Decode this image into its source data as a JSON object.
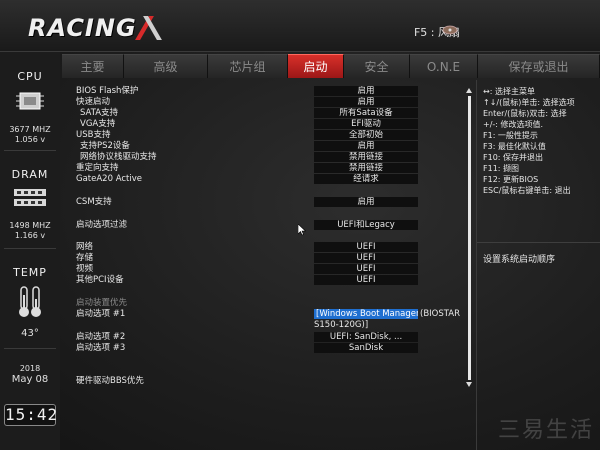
{
  "header": {
    "logo": "RACING",
    "fan_label": "F5 : 风扇"
  },
  "tabs": [
    {
      "label": "主要",
      "active": false
    },
    {
      "label": "高级",
      "active": false
    },
    {
      "label": "芯片组",
      "active": false
    },
    {
      "label": "启动",
      "active": true
    },
    {
      "label": "安全",
      "active": false
    },
    {
      "label": "O.N.E",
      "active": false
    },
    {
      "label": "保存或退出",
      "active": false
    }
  ],
  "sidebar": {
    "cpu_title": "CPU",
    "cpu_freq": "3677 MHZ",
    "cpu_volt": "1.056 v",
    "dram_title": "DRAM",
    "dram_freq": "1498 MHZ",
    "dram_volt": "1.166 v",
    "temp_title": "TEMP",
    "temp_value": "43°",
    "year": "2018",
    "date": "May 08",
    "time": "15:42"
  },
  "settings": [
    {
      "label": "BIOS Flash保护",
      "value": "启用"
    },
    {
      "label": "快速启动",
      "value": "启用"
    },
    {
      "label": "SATA支持",
      "value": "所有Sata设备",
      "indent": true
    },
    {
      "label": "VGA支持",
      "value": "EFI驱动",
      "indent": true
    },
    {
      "label": "USB支持",
      "value": "全部初始"
    },
    {
      "label": "支持PS2设备",
      "value": "启用",
      "indent": true
    },
    {
      "label": "网络协议栈驱动支持",
      "value": "禁用链接",
      "indent": true
    },
    {
      "label": "重定向支持",
      "value": "禁用链接"
    },
    {
      "label": "GateA20 Active",
      "value": "经请求"
    },
    {
      "label": "CSM支持",
      "value": "启用"
    },
    {
      "label": "启动选项过滤",
      "value": "UEFI和Legacy"
    },
    {
      "label": "网络",
      "value": "UEFI"
    },
    {
      "label": "存储",
      "value": "UEFI"
    },
    {
      "label": "视频",
      "value": "UEFI"
    },
    {
      "label": "其他PCI设备",
      "value": "UEFI"
    },
    {
      "label": "启动装置优先",
      "value": ""
    },
    {
      "label": "启动选项 #1",
      "value": "[Windows Boot Manager",
      "extra": "(BIOSTAR",
      "cont": "S150-120G)]"
    },
    {
      "label": "启动选项 #2",
      "value": "UEFI: SanDisk, ..."
    },
    {
      "label": "启动选项 #3",
      "value": "SanDisk"
    },
    {
      "label": "硬件驱动BBS优先",
      "value": ""
    }
  ],
  "help": {
    "lines": [
      "↔: 选择主菜单",
      "↑↓/(鼠标)单击: 选择选项",
      "Enter/(鼠标)双击: 选择",
      "+/-: 修改选项值.",
      "F1: 一般性提示",
      "F3: 最佳化默认值",
      "F10: 保存并退出",
      "F11: 撷图",
      "F12: 更新BIOS",
      "ESC/鼠标右键单击: 退出"
    ],
    "description": "设置系统启动顺序"
  },
  "watermark": "三易生活"
}
